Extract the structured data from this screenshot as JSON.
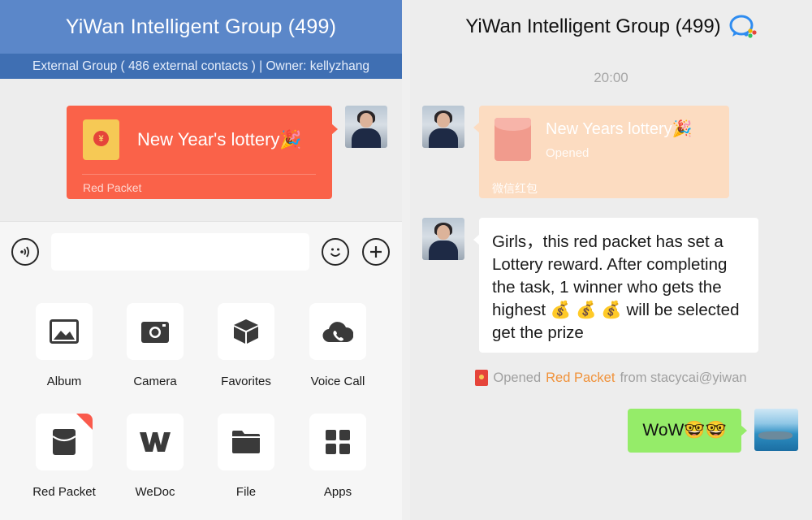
{
  "left": {
    "header_title": "YiWan Intelligent Group (499)",
    "subheader": "External Group ( 486 external contacts ) | Owner: kellyzhang",
    "red_packet": {
      "title": "New Year's lottery",
      "title_emoji": "🎉",
      "footer": "Red Packet",
      "coin_symbol": "¥"
    },
    "tools": [
      {
        "label": "Album",
        "icon": "image-icon"
      },
      {
        "label": "Camera",
        "icon": "camera-icon"
      },
      {
        "label": "Favorites",
        "icon": "cube-icon"
      },
      {
        "label": "Voice Call",
        "icon": "phone-cloud-icon"
      },
      {
        "label": "Red Packet",
        "icon": "envelope-icon"
      },
      {
        "label": "WeDoc",
        "icon": "wedoc-icon"
      },
      {
        "label": "File",
        "icon": "folder-icon"
      },
      {
        "label": "Apps",
        "icon": "apps-grid-icon"
      }
    ]
  },
  "right": {
    "header_title": "YiWan Intelligent Group (499)",
    "time": "20:00",
    "opened_packet": {
      "title": "New Years lottery",
      "title_emoji": "🎉",
      "status": "Opened",
      "source": "微信红包"
    },
    "message": "Girls，this red packet has set a Lottery reward. After completing the task, 1 winner who gets the highest 💰 💰 💰 will be selected get the prize",
    "system": {
      "prefix": "Opened",
      "highlight": "Red Packet",
      "suffix": "from stacycai@yiwan"
    },
    "reply": "WoW🤓🤓"
  },
  "colors": {
    "header_blue": "#5b87c9",
    "red_packet": "#fa6249",
    "opened_packet": "#fcdcc1",
    "reply_green": "#95ec69",
    "highlight_orange": "#f0923a"
  }
}
